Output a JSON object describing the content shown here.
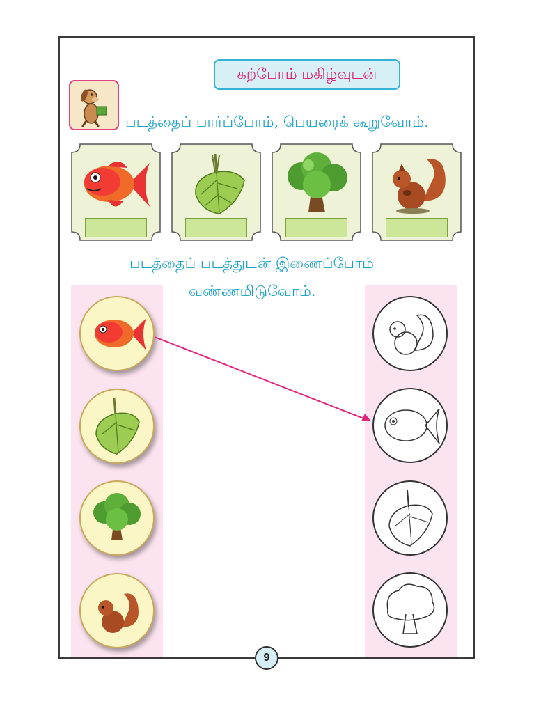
{
  "header": {
    "title": "கற்போம் மகிழ்வுடன்"
  },
  "instructions": {
    "first": "படத்தைப் பார்ப்போம், பெயரைக் கூறுவோம்.",
    "second_line1": "படத்தைப் படத்துடன் இணைப்போம்",
    "second_line2": "வண்ணமிடுவோம்."
  },
  "cards": [
    {
      "icon": "fish-icon"
    },
    {
      "icon": "leaves-icon"
    },
    {
      "icon": "tree-icon"
    },
    {
      "icon": "squirrel-icon"
    }
  ],
  "left_column": [
    "fish-icon",
    "leaves-icon",
    "tree-icon",
    "squirrel-icon"
  ],
  "right_column": [
    "squirrel-outline-icon",
    "fish-outline-icon",
    "leaves-outline-icon",
    "tree-outline-icon"
  ],
  "colors": {
    "accent_title": "#e01f77",
    "instruction": "#1aa3c8",
    "arrow": "#e0257a",
    "column_bg": "#fbe3ef"
  },
  "footer": {
    "page_number": "9"
  }
}
